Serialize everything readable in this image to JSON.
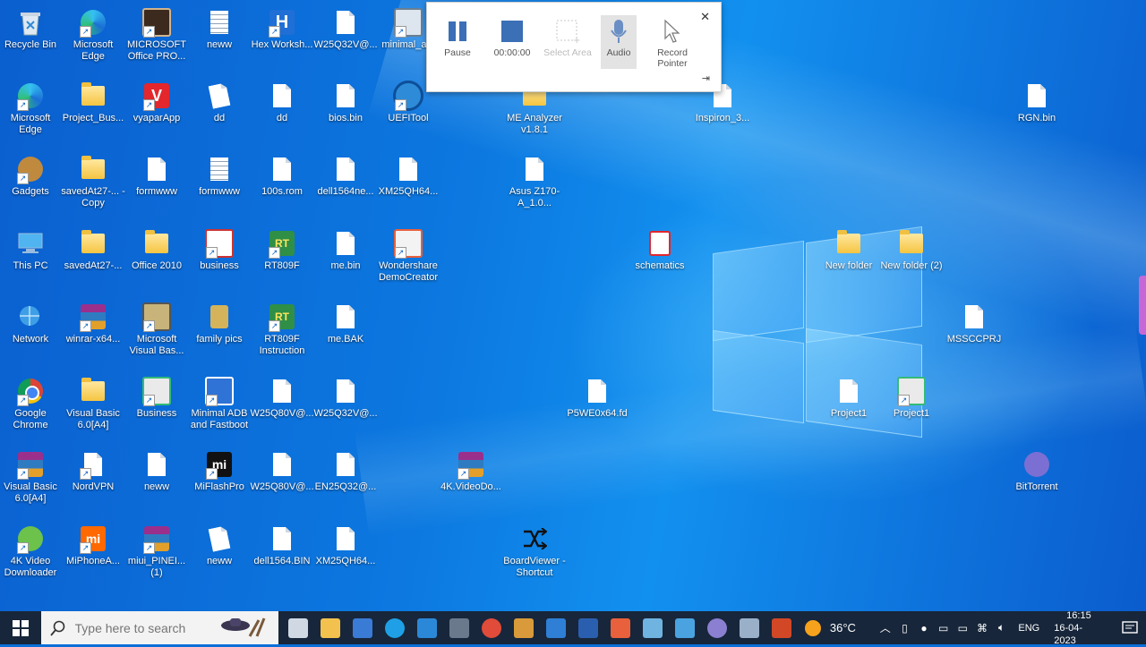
{
  "desktop": {
    "icons": [
      {
        "label": "Recycle Bin",
        "kind": "recycle"
      },
      {
        "label": "Microsoft Edge",
        "kind": "edge"
      },
      {
        "label": "MICROSOFT Office PRO...",
        "kind": "office-box"
      },
      {
        "label": "neww",
        "kind": "doclines"
      },
      {
        "label": "Hex Worksh...",
        "kind": "hex"
      },
      {
        "label": "W25Q32V@...",
        "kind": "doc"
      },
      {
        "label": "minimal_a...",
        "kind": "minimal"
      },
      {
        "label": "Microsoft Edge",
        "kind": "edge"
      },
      {
        "label": "Project_Bus...",
        "kind": "folder"
      },
      {
        "label": "vyaparApp",
        "kind": "vyapar"
      },
      {
        "label": "dd",
        "kind": "doc-tilt"
      },
      {
        "label": "dd",
        "kind": "doc"
      },
      {
        "label": "bios.bin",
        "kind": "doc"
      },
      {
        "label": "UEFITool",
        "kind": "uefi"
      },
      {
        "label": "ME Analyzer v1.8.1",
        "kind": "folder"
      },
      {
        "label": "Inspiron_3...",
        "kind": "doc"
      },
      {
        "label": "RGN.bin",
        "kind": "doc"
      },
      {
        "label": "Gadgets",
        "kind": "gadgets"
      },
      {
        "label": "savedAt27-... - Copy",
        "kind": "folder"
      },
      {
        "label": "formwww",
        "kind": "doc"
      },
      {
        "label": "formwww",
        "kind": "doclines"
      },
      {
        "label": "100s.rom",
        "kind": "doc"
      },
      {
        "label": "dell1564ne...",
        "kind": "doc"
      },
      {
        "label": "XM25QH64...",
        "kind": "doc"
      },
      {
        "label": "Asus Z170-A_1.0...",
        "kind": "doc"
      },
      {
        "label": "This PC",
        "kind": "thispc"
      },
      {
        "label": "savedAt27-...",
        "kind": "folder"
      },
      {
        "label": "Office 2010",
        "kind": "folder"
      },
      {
        "label": "business",
        "kind": "business"
      },
      {
        "label": "RT809F",
        "kind": "rt809f"
      },
      {
        "label": "me.bin",
        "kind": "doc"
      },
      {
        "label": "Wondershare DemoCreator",
        "kind": "wondershare"
      },
      {
        "label": "schematics",
        "kind": "schematics"
      },
      {
        "label": "New folder",
        "kind": "folder"
      },
      {
        "label": "New folder (2)",
        "kind": "folder"
      },
      {
        "label": "Network",
        "kind": "network"
      },
      {
        "label": "winrar-x64...",
        "kind": "winrar"
      },
      {
        "label": "Microsoft Visual Bas...",
        "kind": "vb"
      },
      {
        "label": "family pics",
        "kind": "familypics"
      },
      {
        "label": "RT809F Instruction",
        "kind": "rt809f"
      },
      {
        "label": "me.BAK",
        "kind": "doc"
      },
      {
        "label": "MSSCCPRJ",
        "kind": "doc"
      },
      {
        "label": "Google Chrome",
        "kind": "chrome"
      },
      {
        "label": "Visual Basic 6.0[A4]",
        "kind": "folder"
      },
      {
        "label": "Business",
        "kind": "netpc"
      },
      {
        "label": "Minimal ADB and Fastboot",
        "kind": "adb"
      },
      {
        "label": "W25Q80V@...",
        "kind": "doc"
      },
      {
        "label": "W25Q32V@...",
        "kind": "doc"
      },
      {
        "label": "P5WE0x64.fd",
        "kind": "doc"
      },
      {
        "label": "Project1",
        "kind": "doc"
      },
      {
        "label": "Project1",
        "kind": "netpc"
      },
      {
        "label": "Visual Basic 6.0[A4]",
        "kind": "winrar"
      },
      {
        "label": "NordVPN",
        "kind": "doc-short"
      },
      {
        "label": "neww",
        "kind": "doc"
      },
      {
        "label": "MiFlashPro",
        "kind": "mi-black"
      },
      {
        "label": "W25Q80V@...",
        "kind": "doc"
      },
      {
        "label": "EN25Q32@...",
        "kind": "doc"
      },
      {
        "label": "4K.VideoDo...",
        "kind": "winrar"
      },
      {
        "label": "BitTorrent",
        "kind": "bittorrent"
      },
      {
        "label": "4K Video Downloader",
        "kind": "4kvideo"
      },
      {
        "label": "MiPhoneA...",
        "kind": "mi-orange"
      },
      {
        "label": "miui_PINEI... (1)",
        "kind": "winrar"
      },
      {
        "label": "neww",
        "kind": "doc-tilt"
      },
      {
        "label": "dell1564.BIN",
        "kind": "doc"
      },
      {
        "label": "XM25QH64...",
        "kind": "doc"
      },
      {
        "label": "BoardViewer - Shortcut",
        "kind": "boardviewer"
      }
    ]
  },
  "recorder": {
    "pause_label": "Pause",
    "timer": "00:00:00",
    "select_area_label": "Select Area",
    "audio_label": "Audio",
    "record_pointer_label": "Record Pointer",
    "close_glyph": "✕",
    "pin_glyph": "⇥"
  },
  "taskbar": {
    "search_placeholder": "Type here to search",
    "apps": [
      {
        "name": "task-view",
        "color": "#cfd8e3"
      },
      {
        "name": "file-explorer",
        "color": "#f2c14e"
      },
      {
        "name": "microsoft-store",
        "color": "#3a7bd5"
      },
      {
        "name": "edge",
        "color": "#1fa0e6"
      },
      {
        "name": "mail",
        "color": "#2b88d8"
      },
      {
        "name": "calculator",
        "color": "#6a7a8c"
      },
      {
        "name": "chrome",
        "color": "#e04b3a"
      },
      {
        "name": "4k-app",
        "color": "#d89a3a"
      },
      {
        "name": "vscode-like",
        "color": "#2f7fd6"
      },
      {
        "name": "itc-app",
        "color": "#2a5fb0"
      },
      {
        "name": "democreator",
        "color": "#e8603c"
      },
      {
        "name": "notepad-app",
        "color": "#6fb3e0"
      },
      {
        "name": "remote-app",
        "color": "#4aa3e0"
      },
      {
        "name": "bittorrent",
        "color": "#8a7fd0"
      },
      {
        "name": "network-app",
        "color": "#9ab0c8"
      },
      {
        "name": "powerpoint",
        "color": "#d24726"
      }
    ],
    "weather": "36°C",
    "language": "ENG",
    "time": "16:15",
    "date": "16-04-2023"
  }
}
